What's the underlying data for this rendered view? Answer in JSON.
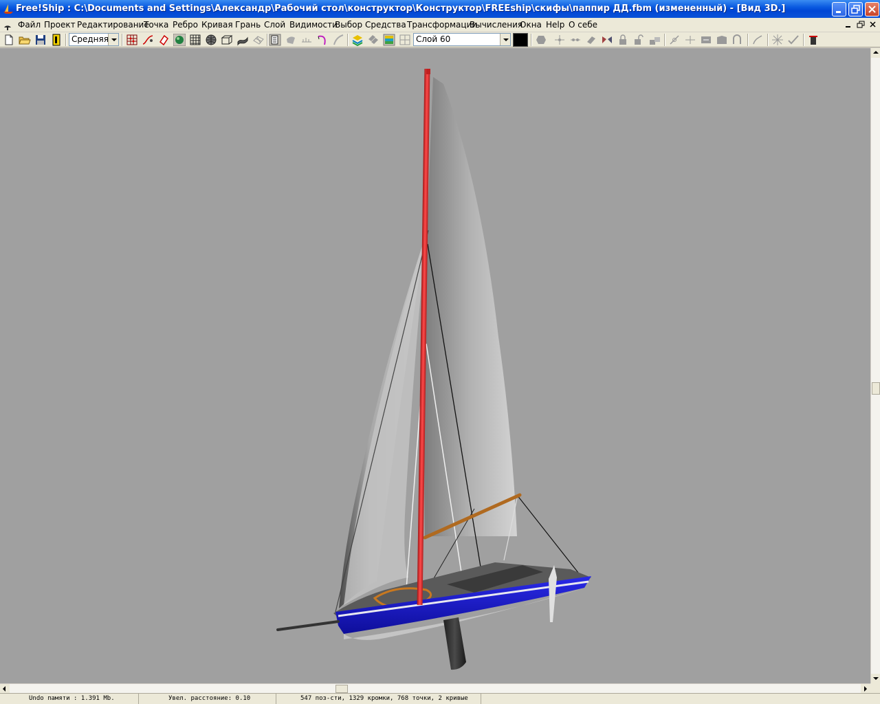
{
  "window": {
    "title": "Free!Ship  : C:\\Documents and Settings\\Александр\\Рабочий стол\\конструктор\\Конструктор\\FREEship\\скифы\\паппир ДД.fbm (измененный) - [Вид 3D.]"
  },
  "menu": {
    "items": [
      "Файл",
      "Проект",
      "Редактирование",
      "Точка",
      "Ребро",
      "Кривая",
      "Грань",
      "Слой",
      "Видимости",
      "Выбор",
      "Средства",
      "Трансформации",
      "Вычисления",
      "Окна",
      "Help",
      "О себе"
    ]
  },
  "toolbar": {
    "precision_value": "Средняя",
    "layer_value": "Слой 60",
    "layer_color": "#000000"
  },
  "status": {
    "undo": "Undo памяти : 1.391 Mb.",
    "distance": "Увел. расстояние: 0.10",
    "counts": "547 поз-сти, 1329 кромки, 768 точки, 2 кривые"
  },
  "colors": {
    "viewport_bg": "#a0a0a0",
    "mast": "#e03030",
    "hull": "#1c1ccc",
    "boom": "#b06a20"
  }
}
